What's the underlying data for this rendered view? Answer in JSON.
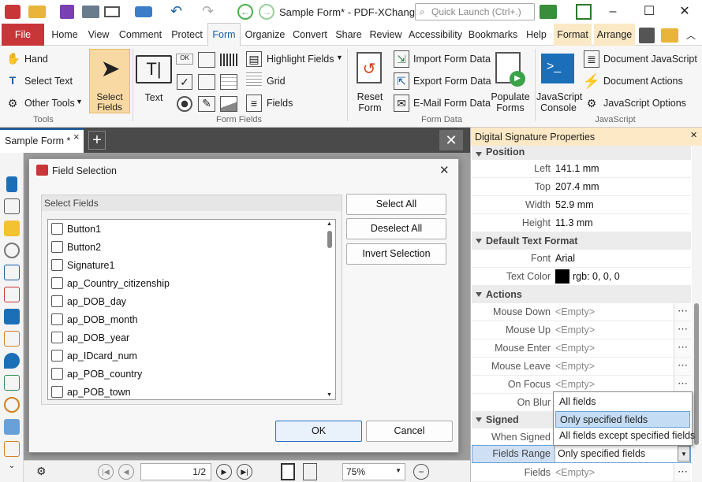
{
  "window": {
    "title": "Sample Form* - PDF-XChange ..",
    "quick_launch_placeholder": "Quick Launch (Ctrl+.)",
    "minimize": "–",
    "maximize": "☐",
    "close": "✕"
  },
  "menu_tabs": [
    "File",
    "Home",
    "View",
    "Comment",
    "Protect",
    "Form",
    "Organize",
    "Convert",
    "Share",
    "Review",
    "Accessibility",
    "Bookmarks",
    "Help",
    "Format",
    "Arrange"
  ],
  "ribbon": {
    "tools": {
      "hand": "Hand",
      "select_text": "Select Text",
      "other_tools": "Other Tools",
      "select_fields": "Select\nFields",
      "group": "Tools"
    },
    "form_fields": {
      "text": "Text",
      "highlight_fields": "Highlight Fields",
      "grid": "Grid",
      "fields": "Fields",
      "group": "Form Fields"
    },
    "form_data": {
      "reset_form_1": "Reset",
      "reset_form_2": "Form",
      "import": "Import Form Data",
      "export": "Export Form Data",
      "email": "E-Mail Form Data",
      "populate_1": "Populate",
      "populate_2": "Forms",
      "group": "Form Data"
    },
    "javascript": {
      "console_1": "JavaScript",
      "console_2": "Console",
      "doc_js": "Document JavaScript",
      "doc_actions": "Document Actions",
      "js_options": "JavaScript Options",
      "group": "JavaScript"
    }
  },
  "doc_tab": {
    "name": "Sample Form *",
    "close": "×",
    "add": "+"
  },
  "dialog": {
    "title": "Field Selection",
    "group_label": "Select Fields",
    "fields": [
      "Button1",
      "Button2",
      "Signature1",
      "ap_Country_citizenship",
      "ap_DOB_day",
      "ap_DOB_month",
      "ap_DOB_year",
      "ap_IDcard_num",
      "ap_POB_country",
      "ap_POB_town"
    ],
    "select_all": "Select All",
    "deselect_all": "Deselect All",
    "invert": "Invert Selection",
    "ok": "OK",
    "cancel": "Cancel"
  },
  "status": {
    "page": "1",
    "page_total": "2",
    "zoom": "75%"
  },
  "panel": {
    "title": "Digital Signature Properties",
    "position": {
      "header": "Position",
      "left_label": "Left",
      "left": "141.1 mm",
      "top_label": "Top",
      "top": "207.4 mm",
      "width_label": "Width",
      "width": "52.9 mm",
      "height_label": "Height",
      "height": "11.3 mm"
    },
    "text_format": {
      "header": "Default Text Format",
      "font_label": "Font",
      "font": "Arial",
      "color_label": "Text Color",
      "color": "rgb: 0, 0, 0"
    },
    "actions": {
      "header": "Actions",
      "mouse_down": "Mouse Down",
      "mouse_up": "Mouse Up",
      "mouse_enter": "Mouse Enter",
      "mouse_leave": "Mouse Leave",
      "on_focus": "On Focus",
      "on_blur": "On Blur",
      "empty": "<Empty>"
    },
    "signed": {
      "header": "Signed",
      "when_signed": "When Signed",
      "fields_range_label": "Fields Range",
      "fields_range": "Only specified fields",
      "fields_label": "Fields",
      "fields": "<Empty>"
    },
    "dropdown": [
      "All fields",
      "Only specified fields",
      "All fields except specified fields"
    ]
  },
  "colors": {
    "file_tab": "#c8363a",
    "accent": "#1b5fa6",
    "panel_header": "#fde9c5"
  }
}
